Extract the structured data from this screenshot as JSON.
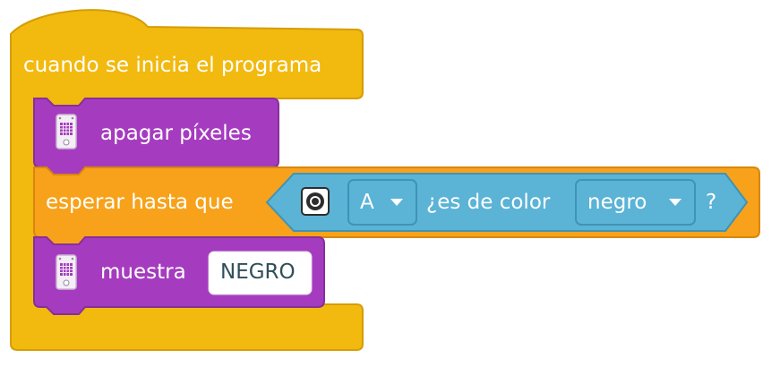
{
  "colors": {
    "event_yellow": "#f2b90f",
    "event_yellow_edge": "#d59d07",
    "control_orange": "#f7a21a",
    "control_orange_edge": "#d9860e",
    "display_purple": "#a53cbf",
    "display_purple_edge": "#863099",
    "sensor_blue": "#5bb3d6",
    "sensor_blue_edge": "#3f93b7",
    "text_white": "#ffffff",
    "input_bg": "#ffffff"
  },
  "hat_block": {
    "label": "cuando se inicia el programa"
  },
  "blocks": [
    {
      "label": "apagar píxeles",
      "icon": "light-matrix-icon"
    },
    {
      "label": "esperar hasta que",
      "condition": {
        "port_icon": "color-sensor-icon",
        "port_value": "A",
        "label": "¿es de color",
        "color_value": "negro",
        "suffix": "?"
      }
    },
    {
      "label": "muestra",
      "icon": "light-matrix-icon",
      "text_value": "NEGRO"
    }
  ]
}
